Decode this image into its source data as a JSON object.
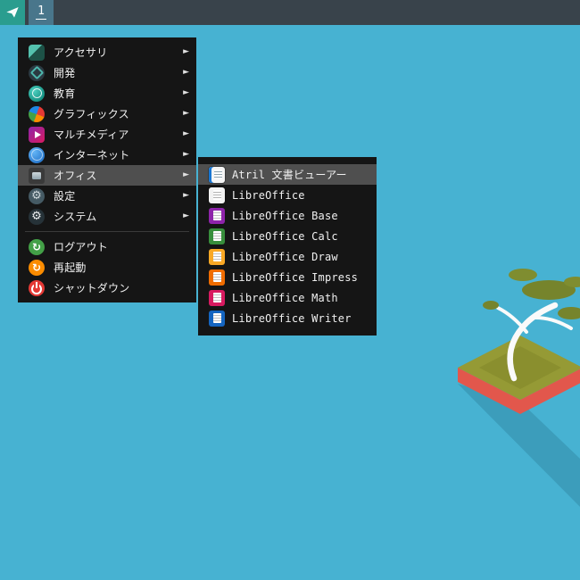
{
  "topbar": {
    "workspace_label": "1"
  },
  "menu": {
    "submenu_arrow": "►",
    "categories": [
      {
        "label": "アクセサリ",
        "icon": "accessories-icon"
      },
      {
        "label": "開発",
        "icon": "development-icon"
      },
      {
        "label": "教育",
        "icon": "education-icon"
      },
      {
        "label": "グラフィックス",
        "icon": "graphics-icon"
      },
      {
        "label": "マルチメディア",
        "icon": "multimedia-icon"
      },
      {
        "label": "インターネット",
        "icon": "internet-icon"
      },
      {
        "label": "オフィス",
        "icon": "office-icon",
        "highlighted": true
      },
      {
        "label": "設定",
        "icon": "settings-icon"
      },
      {
        "label": "システム",
        "icon": "system-icon"
      }
    ],
    "actions": [
      {
        "label": "ログアウト",
        "icon": "logout-icon"
      },
      {
        "label": "再起動",
        "icon": "restart-icon"
      },
      {
        "label": "シャットダウン",
        "icon": "shutdown-icon"
      }
    ]
  },
  "submenu": {
    "items": [
      {
        "label": "Atril 文書ビューアー",
        "icon": "atril-icon",
        "highlighted": true
      },
      {
        "label": "LibreOffice",
        "icon": "libreoffice-icon"
      },
      {
        "label": "LibreOffice Base",
        "icon": "libreoffice-base-icon"
      },
      {
        "label": "LibreOffice Calc",
        "icon": "libreoffice-calc-icon"
      },
      {
        "label": "LibreOffice Draw",
        "icon": "libreoffice-draw-icon"
      },
      {
        "label": "LibreOffice Impress",
        "icon": "libreoffice-impress-icon"
      },
      {
        "label": "LibreOffice Math",
        "icon": "libreoffice-math-icon"
      },
      {
        "label": "LibreOffice Writer",
        "icon": "libreoffice-writer-icon"
      }
    ]
  },
  "colors": {
    "desktop-bg": "#47b2d2",
    "bar-bg": "#39434b",
    "launcher-bg": "#2a9d8f",
    "workspace-bg": "#49768b",
    "menu-bg": "#151515",
    "menu-highlight": "#4f4f4f",
    "menu-text": "#f0f0f0",
    "shadow-band": "#3c9dbb"
  }
}
